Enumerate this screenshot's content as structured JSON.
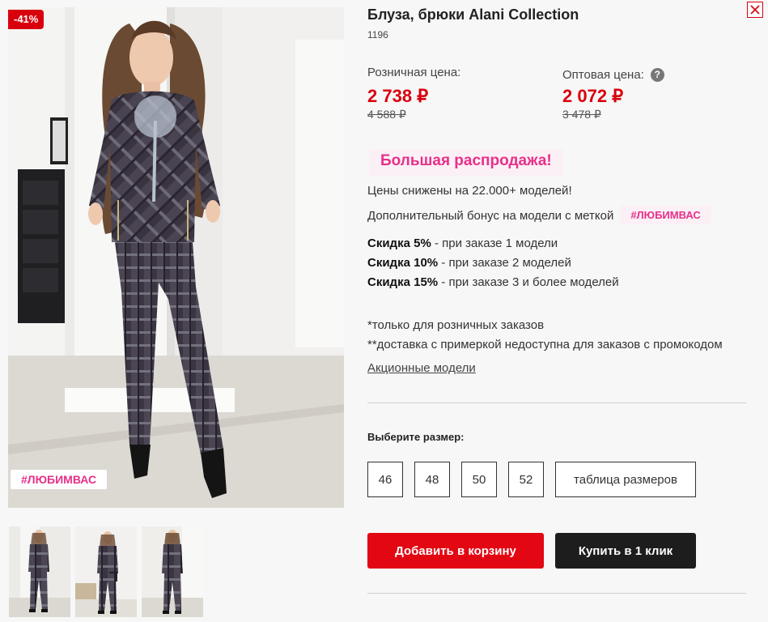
{
  "product": {
    "discount_badge": "-41%",
    "hashtag_badge": "#ЛЮБИМВАС",
    "title": "Блуза, брюки Alani Collection",
    "sku": "1196"
  },
  "prices": {
    "retail_label": "Розничная цена:",
    "retail_current": "2 738 ₽",
    "retail_old": "4 588 ₽",
    "wholesale_label": "Оптовая цена:",
    "wholesale_current": "2 072 ₽",
    "wholesale_old": "3 478 ₽",
    "help_symbol": "?"
  },
  "promo": {
    "sale_title": "Большая распродажа!",
    "line1": "Цены снижены на 22.000+ моделей!",
    "bonus_text": "Дополнительный бонус на модели с меткой",
    "bonus_tag": "#ЛЮБИМВАС",
    "discounts": [
      {
        "bold": "Скидка 5%",
        "rest": " - при заказе 1 модели"
      },
      {
        "bold": "Скидка 10%",
        "rest": " - при заказе 2 моделей"
      },
      {
        "bold": "Скидка 15%",
        "rest": " - при заказе 3 и более моделей"
      }
    ],
    "note1": "*только для розничных заказов",
    "note2": "**доставка с примеркой недоступна для заказов с промокодом",
    "link": "Акционные модели"
  },
  "sizes": {
    "label": "Выберите размер:",
    "options": [
      "46",
      "48",
      "50",
      "52"
    ],
    "table_label": "таблица размеров"
  },
  "actions": {
    "add_to_cart": "Добавить в корзину",
    "buy_one_click": "Купить в 1 клик"
  },
  "colors": {
    "accent_red": "#e30613",
    "sale_pink": "#e8308a",
    "dark_button": "#1d1d1d"
  },
  "icons": {
    "close": "close-icon",
    "help": "question-circle-icon"
  }
}
